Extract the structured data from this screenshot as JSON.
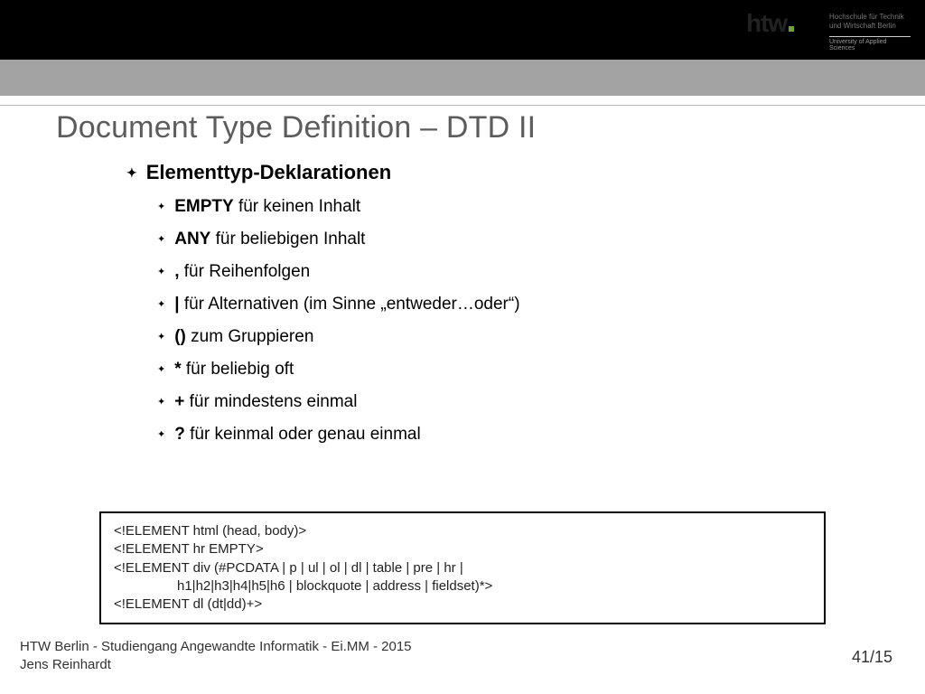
{
  "logo": {
    "main": "htw",
    "sub_line1": "Hochschule für Technik",
    "sub_line2": "und Wirtschaft Berlin",
    "sub2": "University of Applied Sciences"
  },
  "title": "Document Type Definition – DTD II",
  "heading": "Elementtyp-Deklarationen",
  "items": [
    {
      "bold": "EMPTY",
      "rest": " für keinen Inhalt"
    },
    {
      "bold": "ANY",
      "rest": " für beliebigen Inhalt"
    },
    {
      "bold": ",",
      "rest": " für Reihenfolgen"
    },
    {
      "bold": "|",
      "rest": " für Alternativen (im Sinne „entweder…oder“)"
    },
    {
      "bold": "()",
      "rest": " zum Gruppieren"
    },
    {
      "bold": "*",
      "rest": " für beliebig oft"
    },
    {
      "bold": "+",
      "rest": " für mindestens einmal"
    },
    {
      "bold": "?",
      "rest": " für keinmal oder genau einmal"
    }
  ],
  "code": {
    "l1": "<!ELEMENT html (head, body)>",
    "l2": "<!ELEMENT hr EMPTY>",
    "l3": "<!ELEMENT div (#PCDATA | p | ul | ol | dl | table | pre | hr |",
    "l4": "h1|h2|h3|h4|h5|h6 | blockquote | address | fieldset)*>",
    "l5": "<!ELEMENT dl (dt|dd)+>"
  },
  "footer": {
    "line1": "HTW Berlin - Studiengang Angewandte Informatik - Ei.MM - 2015",
    "line2": "Jens Reinhardt"
  },
  "pagenum": "41/15"
}
